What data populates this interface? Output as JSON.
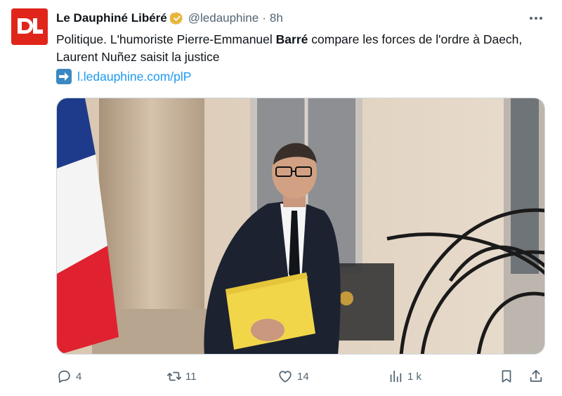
{
  "account": {
    "name": "Le Dauphiné Libéré",
    "handle": "@ledauphine",
    "separator": "·",
    "time": "8h",
    "logo_text": "DL",
    "verified_color": "#e8b53c"
  },
  "post": {
    "text_before": "Politique. L'humoriste Pierre-Emmanuel ",
    "text_bold": "Barré",
    "text_after": " compare les forces de l'ordre à Daech, Laurent Nuñez saisit la justice",
    "link_emoji": "➡️",
    "link_text": "l.ledauphine.com/plP"
  },
  "actions": {
    "replies": "4",
    "reposts": "11",
    "likes": "14",
    "views": "1 k"
  },
  "colors": {
    "accent": "#1d9bf0",
    "brand": "#e0251b",
    "muted": "#536471"
  }
}
